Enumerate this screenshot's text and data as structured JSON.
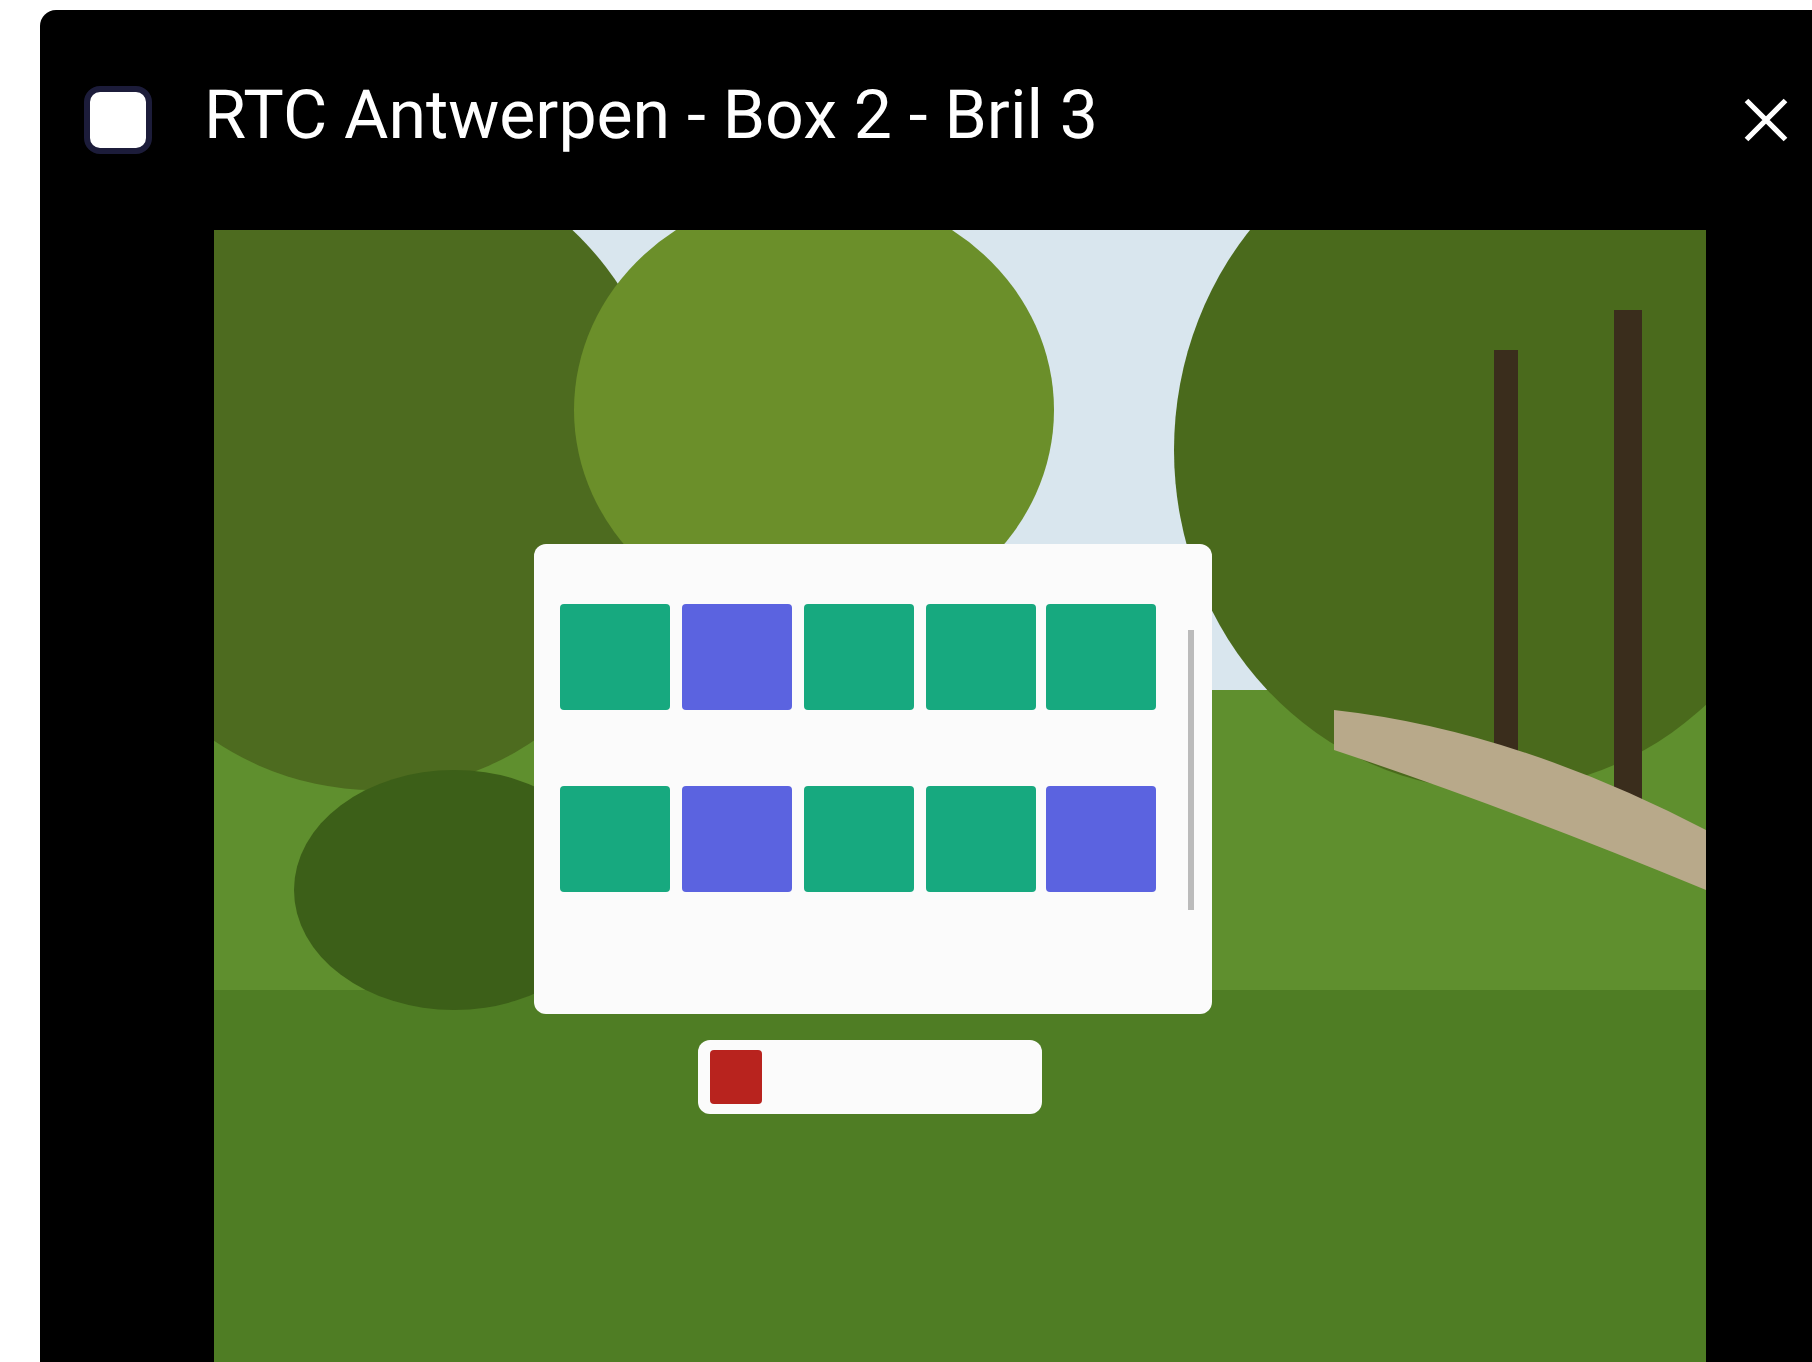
{
  "window": {
    "title": "RTC Antwerpen - Box 2 - Bril 3"
  }
}
